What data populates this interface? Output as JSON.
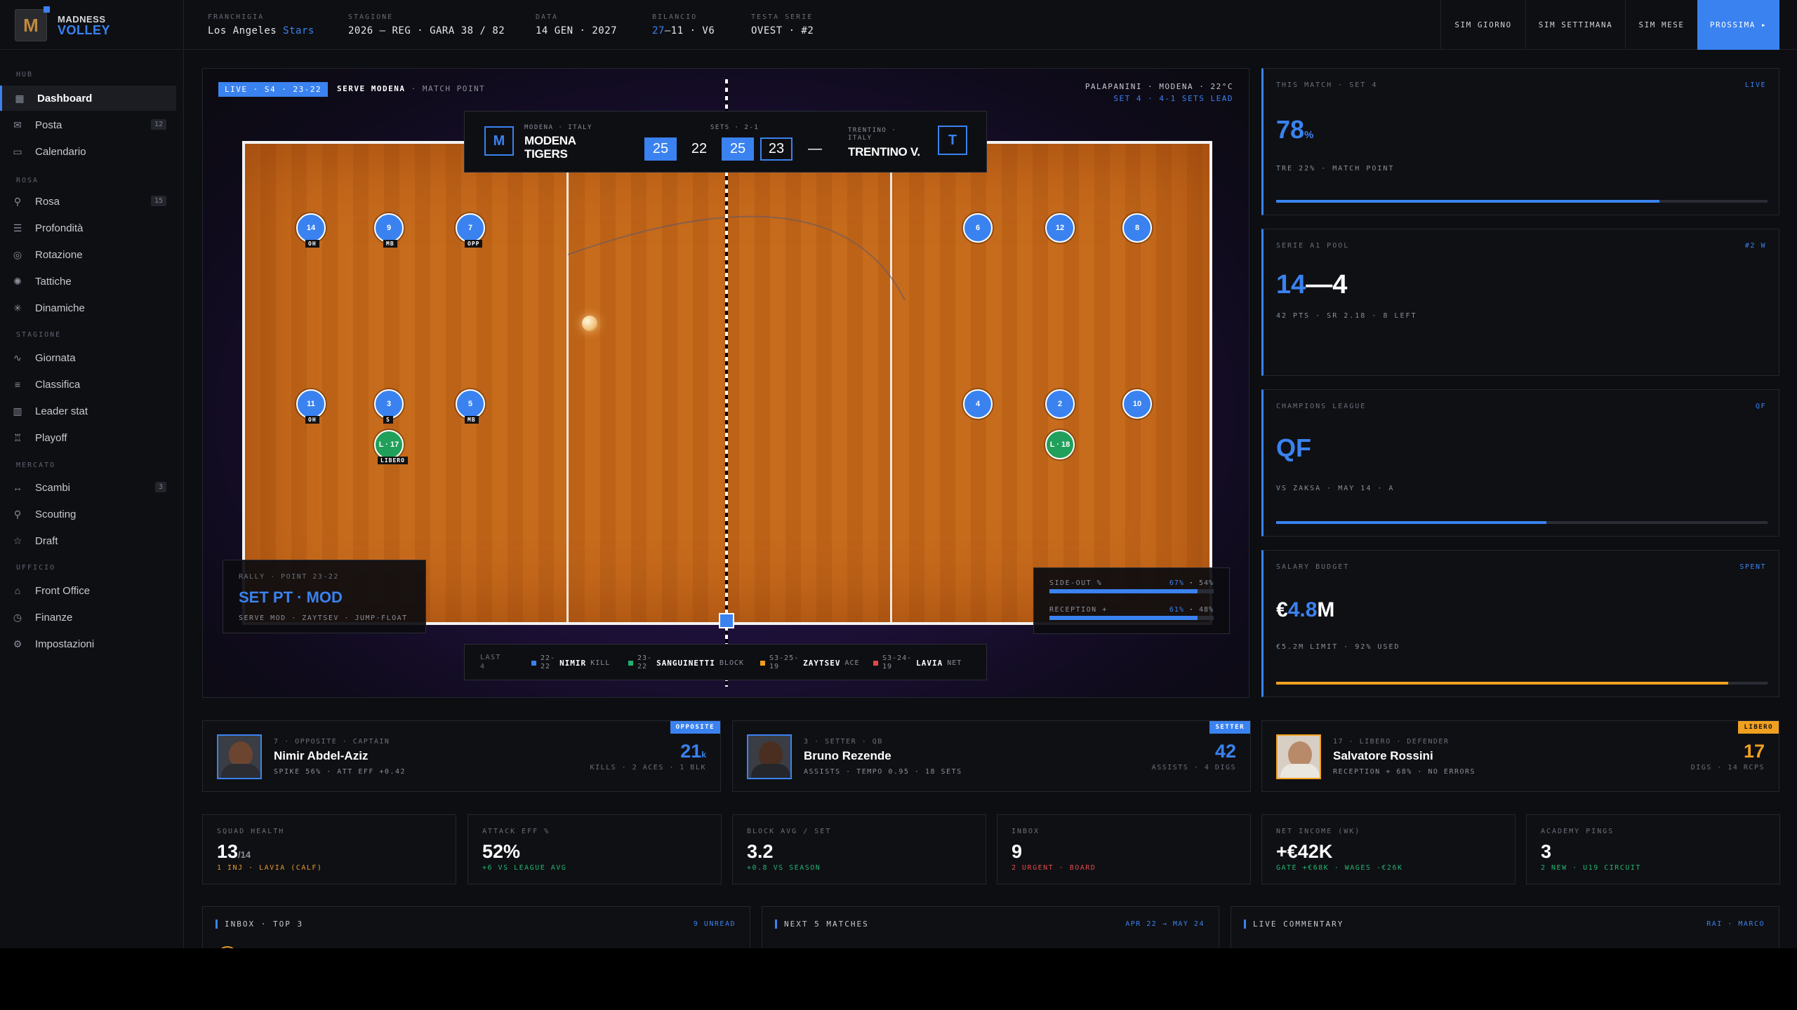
{
  "brand": {
    "line1": "MADNESS",
    "line2": "VOLLEY",
    "logo_letter": "M"
  },
  "topbar": {
    "franchise": {
      "label": "FRANCHIGIA",
      "city": "Los Angeles",
      "team": "Stars"
    },
    "season": {
      "label": "STAGIONE",
      "value": "2026 — REG · GARA 38 / 82"
    },
    "date": {
      "label": "DATA",
      "value": "14 GEN · 2027"
    },
    "record": {
      "label": "BILANCIO",
      "wins": "27",
      "rest": "—11 · V6"
    },
    "series_lead": {
      "label": "TESTA SERIE",
      "value": "OVEST · #2"
    },
    "buttons": {
      "sim_day": "SIM GIORNO",
      "sim_week": "SIM SETTIMANA",
      "sim_month": "SIM MESE",
      "next": "PROSSIMA ▸"
    }
  },
  "sidebar": {
    "sections": [
      "HUB",
      "ROSA",
      "STAGIONE",
      "MERCATO",
      "UFFICIO"
    ],
    "items": [
      {
        "label": "Dashboard",
        "icon": "grid-icon"
      },
      {
        "label": "Posta",
        "icon": "mail-icon",
        "count": "12"
      },
      {
        "label": "Calendario",
        "icon": "calendar-icon"
      },
      {
        "label": "Rosa",
        "icon": "person-icon",
        "count": "15"
      },
      {
        "label": "Profondità",
        "icon": "layers-icon"
      },
      {
        "label": "Rotazione",
        "icon": "target-icon"
      },
      {
        "label": "Tattiche",
        "icon": "spinner-icon"
      },
      {
        "label": "Dinamiche",
        "icon": "sparkle-icon"
      },
      {
        "label": "Giornata",
        "icon": "pulse-icon"
      },
      {
        "label": "Classifica",
        "icon": "list-icon"
      },
      {
        "label": "Leader stat",
        "icon": "bars-icon"
      },
      {
        "label": "Playoff",
        "icon": "trophy-icon"
      },
      {
        "label": "Scambi",
        "icon": "swap-icon",
        "count": "3"
      },
      {
        "label": "Scouting",
        "icon": "search-icon"
      },
      {
        "label": "Draft",
        "icon": "star-icon"
      },
      {
        "label": "Front Office",
        "icon": "bank-icon"
      },
      {
        "label": "Finanze",
        "icon": "clock-icon"
      },
      {
        "label": "Impostazioni",
        "icon": "gear-icon"
      }
    ]
  },
  "match": {
    "live_tag": "LIVE · S4 · 23-22",
    "serve": "SERVE MODENA",
    "serve_dim": "· MATCH POINT",
    "venue": "PALAPANINI · MODENA · 22°C",
    "set_info": "SET 4 · 4-1 SETS LEAD",
    "home": {
      "letter": "M",
      "sub": "MODENA · ITALY",
      "name1": "MODENA",
      "name2": "TIGERS"
    },
    "away": {
      "letter": "T",
      "sub1": "TRENTINO ·",
      "sub2": "ITALY",
      "name": "TRENTINO V."
    },
    "sets_label": "SETS · 2-1",
    "set_scores": [
      "25",
      "22",
      "25",
      "23",
      "—"
    ],
    "players_left": [
      {
        "num": "14",
        "pos": "OH"
      },
      {
        "num": "9",
        "pos": "MB"
      },
      {
        "num": "7",
        "pos": "OPP"
      },
      {
        "num": "11",
        "pos": "OH"
      },
      {
        "num": "3",
        "pos": "S"
      },
      {
        "num": "5",
        "pos": "MB"
      },
      {
        "num": "L · 17",
        "pos": "LIBERO"
      }
    ],
    "players_right": [
      {
        "num": "6"
      },
      {
        "num": "12"
      },
      {
        "num": "8"
      },
      {
        "num": "4"
      },
      {
        "num": "2"
      },
      {
        "num": "10"
      },
      {
        "num": "L · 18"
      }
    ],
    "rally": {
      "label": "RALLY · POINT 23-22",
      "title": "SET PT · MOD",
      "sub": "SERVE MOD · ZAYTSEV · JUMP-FLOAT"
    },
    "stats": [
      {
        "label": "SIDE-OUT %",
        "home": "67%",
        "away": "54%",
        "value": 0.9
      },
      {
        "label": "RECEPTION +",
        "home": "61%",
        "away": "48%",
        "value": 0.9
      }
    ],
    "last": {
      "label1": "LAST",
      "label2": "4",
      "items": [
        {
          "s1": "22-",
          "s2": "22",
          "player": "NIMIR",
          "action": "KILL",
          "color": "#3a82f0"
        },
        {
          "s1": "23-",
          "s2": "22",
          "player": "SANGUINETTI",
          "action": "BLOCK",
          "color": "#20b070"
        },
        {
          "s1": "S3-25-",
          "s2": "19",
          "player": "ZAYTSEV",
          "action": "ACE",
          "color": "#f0a020"
        },
        {
          "s1": "S3-24-",
          "s2": "19",
          "player": "LAVIA",
          "action": "NET",
          "color": "#e04848"
        }
      ]
    }
  },
  "right_cards": [
    {
      "label": "THIS MATCH · SET 4",
      "tag": "LIVE",
      "big": "78",
      "unit": "%",
      "sub": "TRE 22% · MATCH POINT",
      "progress": 0.78
    },
    {
      "label": "SERIE A1 POOL",
      "tag": "#2 W",
      "big_a": "14",
      "big_b": "—4",
      "sub": "42 PTS · SR 2.18 · 8 LEFT"
    },
    {
      "label": "CHAMPIONS LEAGUE",
      "tag": "QF",
      "big": "QF",
      "sub": "VS ZAKSA · MAY 14 · A",
      "progress": 0.55
    },
    {
      "label": "SALARY BUDGET",
      "tag": "SPENT",
      "pre": "€",
      "big": "4.8",
      "unit": "M",
      "sub": "€5.2M LIMIT · 92% USED",
      "progress": 0.92
    }
  ],
  "player_cards": [
    {
      "role": "7 · OPPOSITE · CAPTAIN",
      "name": "Nimir Abdel-Aziz",
      "stats": "SPIKE 56% · ATT EFF +0.42",
      "tag": "OPPOSITE",
      "value": "21",
      "unit": "k",
      "vsub": "KILLS · 2 ACES · 1 BLK"
    },
    {
      "role": "3 · SETTER · QB",
      "name": "Bruno Rezende",
      "stats": "ASSISTS · TEMPO 0.95 · 18 SETS",
      "tag": "SETTER",
      "value": "42",
      "unit": "",
      "vsub": "ASSISTS · 4 DIGS"
    },
    {
      "role": "17 · LIBERO · DEFENDER",
      "name": "Salvatore Rossini",
      "stats": "RECEPTION + 68% · NO ERRORS",
      "tag": "LIBERO",
      "value": "17",
      "unit": "",
      "vsub": "DIGS · 14 RCPS"
    }
  ],
  "kpis": [
    {
      "label": "SQUAD HEALTH",
      "value": "13",
      "unit": "/14",
      "sub": "1 INJ · LAVIA (CALF)",
      "color": "#e59a2a"
    },
    {
      "label": "ATTACK EFF %",
      "value": "52%",
      "unit": "",
      "sub": "+6 VS LEAGUE AVG",
      "color": "#22b472"
    },
    {
      "label": "BLOCK AVG / SET",
      "value": "3.2",
      "unit": "",
      "sub": "+0.8 VS SEASON",
      "color": "#22b472"
    },
    {
      "label": "INBOX",
      "value": "9",
      "unit": "",
      "sub": "2 URGENT · BOARD",
      "color": "#e04848"
    },
    {
      "label": "NET INCOME (WK)",
      "value": "+€42K",
      "unit": "",
      "sub": "GATE +€68K · WAGES -€26K",
      "color": "#22b472"
    },
    {
      "label": "ACADEMY PINGS",
      "value": "3",
      "unit": "",
      "sub": "2 NEW · U19 CIRCUIT",
      "color": "#22b472"
    }
  ],
  "bottom_panels": [
    {
      "label": "INBOX · TOP 3",
      "right": "9 UNREAD"
    },
    {
      "label": "NEXT 5 MATCHES",
      "right": "APR 22 → MAY 24"
    },
    {
      "label": "LIVE COMMENTARY",
      "right": "RAI · MARCO"
    }
  ],
  "colors": {
    "accent": "#3a82f0",
    "gold": "#f0a020",
    "green": "#20a05a",
    "red": "#e04848"
  }
}
